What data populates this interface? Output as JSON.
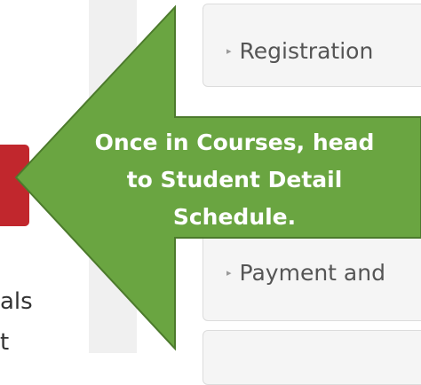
{
  "left_text": [
    "als",
    "t"
  ],
  "panels": [
    {
      "label": "Registration",
      "caret": "▸"
    },
    {
      "label": "Payment and",
      "caret": "▸"
    }
  ],
  "callout": {
    "lines": [
      "Once in Courses, head",
      "to Student Detail",
      "Schedule."
    ],
    "fill": "#6aa541",
    "stroke": "#4c7a2c"
  }
}
